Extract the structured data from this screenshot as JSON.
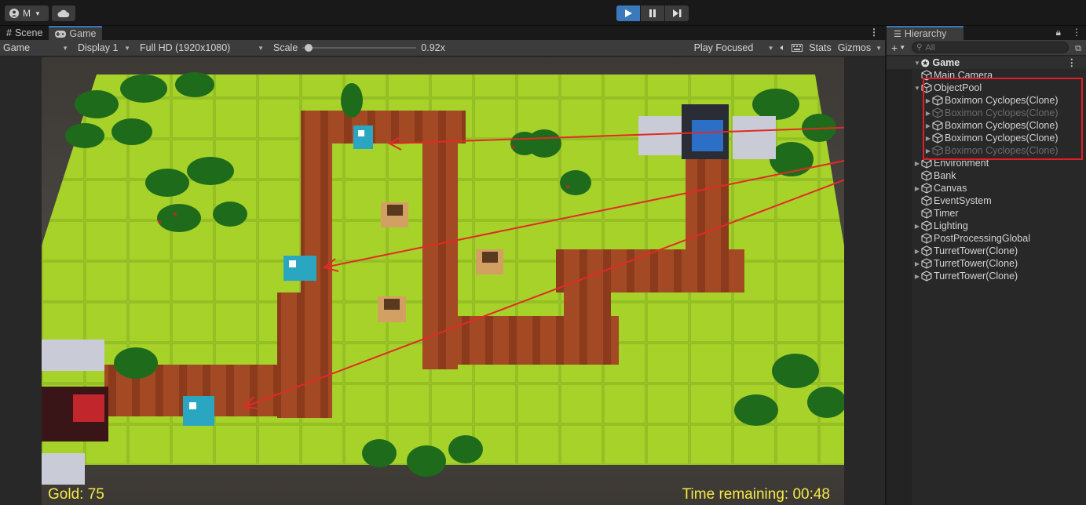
{
  "toolbar": {
    "account_label": "M",
    "play_icon": "play-icon",
    "pause_icon": "pause-icon",
    "step_icon": "step-icon"
  },
  "game_panel": {
    "tabs": [
      {
        "label": "Scene",
        "icon": "grid-icon"
      },
      {
        "label": "Game",
        "icon": "gamepad-icon"
      }
    ],
    "view_select": "Game",
    "display_select": "Display 1",
    "resolution_select": "Full HD (1920x1080)",
    "scale_label": "Scale",
    "scale_value": "0.92x",
    "scale_level": 0.02,
    "play_mode_select": "Play Focused",
    "stats_label": "Stats",
    "gizmos_label": "Gizmos"
  },
  "hud": {
    "gold": "Gold: 75",
    "time_remaining": "Time remaining: 00:48"
  },
  "hierarchy": {
    "tab_label": "Hierarchy",
    "search_placeholder": "All",
    "scene_name": "Game",
    "items": [
      {
        "label": "Main Camera",
        "depth": 1,
        "expandable": false,
        "dim": false
      },
      {
        "label": "ObjectPool",
        "depth": 1,
        "expandable": true,
        "expanded": true,
        "dim": false
      },
      {
        "label": "Boximon Cyclopes(Clone)",
        "depth": 2,
        "expandable": true,
        "dim": false
      },
      {
        "label": "Boximon Cyclopes(Clone)",
        "depth": 2,
        "expandable": true,
        "dim": true
      },
      {
        "label": "Boximon Cyclopes(Clone)",
        "depth": 2,
        "expandable": true,
        "dim": false
      },
      {
        "label": "Boximon Cyclopes(Clone)",
        "depth": 2,
        "expandable": true,
        "dim": false
      },
      {
        "label": "Boximon Cyclopes(Clone)",
        "depth": 2,
        "expandable": true,
        "dim": true
      },
      {
        "label": "Environment",
        "depth": 1,
        "expandable": true,
        "dim": false
      },
      {
        "label": "Bank",
        "depth": 1,
        "expandable": false,
        "dim": false
      },
      {
        "label": "Canvas",
        "depth": 1,
        "expandable": true,
        "dim": false
      },
      {
        "label": "EventSystem",
        "depth": 1,
        "expandable": false,
        "dim": false
      },
      {
        "label": "Timer",
        "depth": 1,
        "expandable": false,
        "dim": false
      },
      {
        "label": "Lighting",
        "depth": 1,
        "expandable": true,
        "dim": false
      },
      {
        "label": "PostProcessingGlobal",
        "depth": 1,
        "expandable": false,
        "dim": false
      },
      {
        "label": "TurretTower(Clone)",
        "depth": 1,
        "expandable": true,
        "dim": false
      },
      {
        "label": "TurretTower(Clone)",
        "depth": 1,
        "expandable": true,
        "dim": false
      },
      {
        "label": "TurretTower(Clone)",
        "depth": 1,
        "expandable": true,
        "dim": false
      }
    ]
  },
  "colors": {
    "accent_blue": "#3a79bb",
    "annotation_red": "#e11d25",
    "hud_yellow": "#f4e94a",
    "grass": "#a8d42c",
    "path": "#8e3d1f"
  }
}
